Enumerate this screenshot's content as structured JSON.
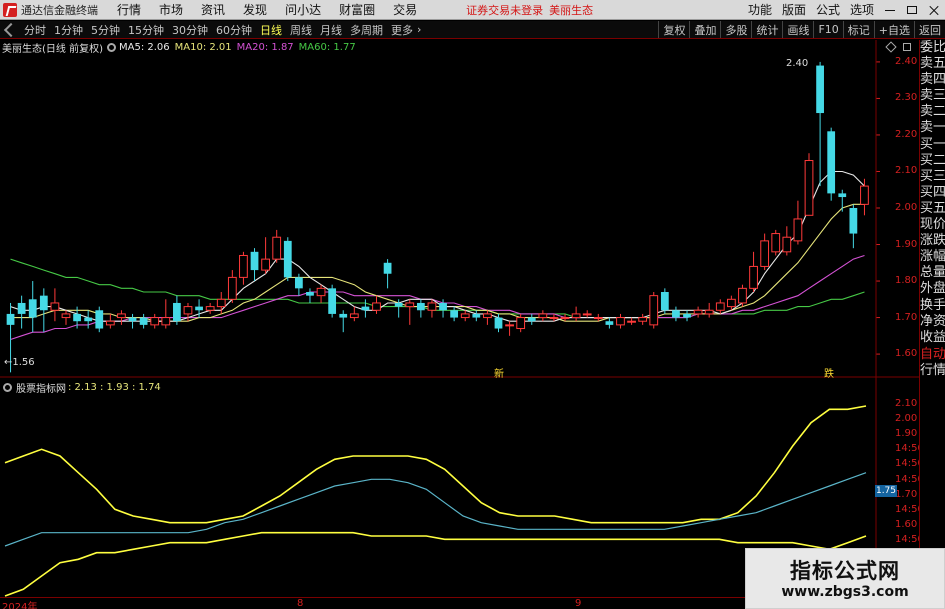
{
  "menubar": {
    "app_title": "通达信金融终端",
    "items": [
      "行情",
      "市场",
      "资讯",
      "发现",
      "问小达",
      "财富圈",
      "交易"
    ],
    "alert": "证券交易未登录",
    "current_stock": "美丽生态",
    "right_items": [
      "功能",
      "版面",
      "公式",
      "选项"
    ]
  },
  "periodbar": {
    "periods": [
      "分时",
      "1分钟",
      "5分钟",
      "15分钟",
      "30分钟",
      "60分钟",
      "日线",
      "周线",
      "月线",
      "多周期",
      "更多"
    ],
    "active_period": "日线",
    "tools": [
      "复权",
      "叠加",
      "多股",
      "统计",
      "画线",
      "F10",
      "标记",
      "+自选",
      "返回"
    ]
  },
  "chart_header": {
    "stock_label": "美丽生态(日线 前复权)",
    "ma5": "MA5: 2.06",
    "ma10": "MA10: 2.01",
    "ma20": "MA20: 1.87",
    "ma60": "MA60: 1.77"
  },
  "indicator_header": {
    "name": "股票指标网",
    "values": ": 2.13 : 1.93 : 1.74"
  },
  "price_axis": [
    "2.40",
    "2.30",
    "2.20",
    "2.10",
    "2.00",
    "1.90",
    "1.80",
    "1.70",
    "1.60"
  ],
  "indicator_axis": [
    "2.10",
    "2.00",
    "1.90",
    "14:50",
    "14:50",
    "14:50",
    "1.70",
    "14:50",
    "1.60",
    "14:50"
  ],
  "indicator_value_box": "1.75",
  "annotations": {
    "high": "2.40",
    "low": "←1.56",
    "low_marker": "新",
    "high_marker": "跌"
  },
  "date_axis": [
    "2024年",
    "8",
    "9"
  ],
  "side_panel": {
    "top": [
      "委比",
      "卖五",
      "卖四",
      "卖三",
      "卖二",
      "卖一",
      "买一",
      "买二",
      "买三",
      "买四",
      "买五",
      "现价",
      "涨跌",
      "涨幅",
      "总量",
      "外盘",
      "换手",
      "净资",
      "收益"
    ],
    "bottom": [
      "自动",
      "行情"
    ]
  },
  "watermark": {
    "title": "指标公式网",
    "url": "www.zbgs3.com"
  },
  "colors": {
    "up": "#ff3a3a",
    "down": "#45d9e6",
    "ma5": "#e8e8e8",
    "ma10": "#e6e47a",
    "ma20": "#d452d4",
    "ma60": "#46c846",
    "band_upper": "#ffff40",
    "band_mid": "#5ab4c8",
    "band_lower": "#ffff40"
  },
  "chart_data": [
    {
      "type": "candlestick",
      "title": "美丽生态(日线 前复权)",
      "ylim": [
        1.54,
        2.46
      ],
      "x_labels": [
        "2024年",
        "8",
        "9"
      ],
      "candles": [
        [
          1.71,
          1.68,
          1.74,
          1.55
        ],
        [
          1.74,
          1.71,
          1.76,
          1.67
        ],
        [
          1.75,
          1.7,
          1.8,
          1.66
        ],
        [
          1.76,
          1.72,
          1.78,
          1.66
        ],
        [
          1.72,
          1.74,
          1.78,
          1.69
        ],
        [
          1.7,
          1.71,
          1.72,
          1.68
        ],
        [
          1.71,
          1.69,
          1.73,
          1.67
        ],
        [
          1.7,
          1.69,
          1.72,
          1.67
        ],
        [
          1.72,
          1.67,
          1.73,
          1.66
        ],
        [
          1.68,
          1.69,
          1.71,
          1.67
        ],
        [
          1.7,
          1.71,
          1.72,
          1.68
        ],
        [
          1.7,
          1.69,
          1.71,
          1.67
        ],
        [
          1.7,
          1.68,
          1.71,
          1.67
        ],
        [
          1.68,
          1.7,
          1.71,
          1.67
        ],
        [
          1.68,
          1.7,
          1.75,
          1.67
        ],
        [
          1.74,
          1.69,
          1.76,
          1.68
        ],
        [
          1.71,
          1.73,
          1.74,
          1.69
        ],
        [
          1.73,
          1.72,
          1.75,
          1.7
        ],
        [
          1.72,
          1.73,
          1.74,
          1.71
        ],
        [
          1.73,
          1.75,
          1.77,
          1.71
        ],
        [
          1.75,
          1.81,
          1.83,
          1.74
        ],
        [
          1.81,
          1.87,
          1.88,
          1.79
        ],
        [
          1.88,
          1.83,
          1.89,
          1.8
        ],
        [
          1.83,
          1.86,
          1.92,
          1.82
        ],
        [
          1.86,
          1.92,
          1.94,
          1.85
        ],
        [
          1.91,
          1.81,
          1.92,
          1.8
        ],
        [
          1.81,
          1.78,
          1.82,
          1.76
        ],
        [
          1.77,
          1.76,
          1.78,
          1.74
        ],
        [
          1.76,
          1.78,
          1.79,
          1.74
        ],
        [
          1.78,
          1.71,
          1.79,
          1.7
        ],
        [
          1.71,
          1.7,
          1.72,
          1.66
        ],
        [
          1.7,
          1.71,
          1.73,
          1.69
        ],
        [
          1.73,
          1.72,
          1.75,
          1.7
        ],
        [
          1.72,
          1.74,
          1.76,
          1.71
        ],
        [
          1.85,
          1.82,
          1.86,
          1.78
        ],
        [
          1.74,
          1.73,
          1.75,
          1.7
        ],
        [
          1.73,
          1.74,
          1.75,
          1.68
        ],
        [
          1.74,
          1.72,
          1.75,
          1.7
        ],
        [
          1.72,
          1.74,
          1.75,
          1.7
        ],
        [
          1.74,
          1.72,
          1.75,
          1.7
        ],
        [
          1.72,
          1.7,
          1.73,
          1.69
        ],
        [
          1.7,
          1.71,
          1.72,
          1.69
        ],
        [
          1.71,
          1.7,
          1.72,
          1.69
        ],
        [
          1.7,
          1.71,
          1.72,
          1.68
        ],
        [
          1.7,
          1.67,
          1.71,
          1.66
        ],
        [
          1.68,
          1.68,
          1.69,
          1.65
        ],
        [
          1.67,
          1.7,
          1.71,
          1.66
        ],
        [
          1.7,
          1.69,
          1.71,
          1.68
        ],
        [
          1.7,
          1.71,
          1.72,
          1.69
        ],
        [
          1.7,
          1.7,
          1.71,
          1.69
        ],
        [
          1.7,
          1.7,
          1.71,
          1.69
        ],
        [
          1.7,
          1.71,
          1.73,
          1.69
        ],
        [
          1.71,
          1.71,
          1.72,
          1.7
        ],
        [
          1.7,
          1.7,
          1.71,
          1.69
        ],
        [
          1.69,
          1.68,
          1.7,
          1.67
        ],
        [
          1.68,
          1.7,
          1.71,
          1.67
        ],
        [
          1.69,
          1.69,
          1.7,
          1.68
        ],
        [
          1.69,
          1.7,
          1.71,
          1.68
        ],
        [
          1.68,
          1.76,
          1.77,
          1.67
        ],
        [
          1.77,
          1.72,
          1.78,
          1.71
        ],
        [
          1.72,
          1.7,
          1.73,
          1.69
        ],
        [
          1.71,
          1.7,
          1.72,
          1.69
        ],
        [
          1.71,
          1.72,
          1.73,
          1.7
        ],
        [
          1.71,
          1.72,
          1.74,
          1.7
        ],
        [
          1.72,
          1.74,
          1.75,
          1.71
        ],
        [
          1.73,
          1.75,
          1.76,
          1.72
        ],
        [
          1.74,
          1.78,
          1.79,
          1.73
        ],
        [
          1.78,
          1.84,
          1.88,
          1.77
        ],
        [
          1.84,
          1.91,
          1.93,
          1.83
        ],
        [
          1.88,
          1.93,
          1.94,
          1.87
        ],
        [
          1.88,
          1.92,
          1.95,
          1.87
        ],
        [
          1.91,
          1.97,
          2.02,
          1.9
        ],
        [
          1.98,
          2.13,
          2.15,
          1.98
        ],
        [
          2.39,
          2.26,
          2.4,
          2.06
        ],
        [
          2.21,
          2.04,
          2.22,
          2.02
        ],
        [
          2.04,
          2.03,
          2.05,
          1.99
        ],
        [
          2.0,
          1.93,
          2.01,
          1.89
        ],
        [
          2.01,
          2.06,
          2.08,
          1.98
        ]
      ],
      "ma5": [
        1.73,
        1.72,
        1.72,
        1.73,
        1.73,
        1.72,
        1.71,
        1.7,
        1.69,
        1.69,
        1.69,
        1.69,
        1.69,
        1.69,
        1.69,
        1.69,
        1.7,
        1.71,
        1.72,
        1.72,
        1.75,
        1.78,
        1.8,
        1.82,
        1.86,
        1.86,
        1.84,
        1.81,
        1.79,
        1.77,
        1.75,
        1.73,
        1.72,
        1.72,
        1.74,
        1.74,
        1.75,
        1.75,
        1.75,
        1.73,
        1.73,
        1.72,
        1.71,
        1.71,
        1.7,
        1.69,
        1.69,
        1.69,
        1.69,
        1.69,
        1.7,
        1.7,
        1.7,
        1.7,
        1.7,
        1.7,
        1.7,
        1.7,
        1.71,
        1.72,
        1.72,
        1.72,
        1.72,
        1.72,
        1.71,
        1.72,
        1.74,
        1.77,
        1.82,
        1.86,
        1.9,
        1.93,
        2.0,
        2.07,
        2.1,
        2.1,
        2.09,
        2.06
      ],
      "ma10": [
        1.7,
        1.7,
        1.7,
        1.71,
        1.72,
        1.72,
        1.72,
        1.72,
        1.71,
        1.71,
        1.7,
        1.7,
        1.7,
        1.69,
        1.69,
        1.69,
        1.69,
        1.7,
        1.7,
        1.71,
        1.72,
        1.74,
        1.75,
        1.77,
        1.79,
        1.81,
        1.81,
        1.81,
        1.81,
        1.81,
        1.8,
        1.79,
        1.77,
        1.76,
        1.75,
        1.74,
        1.73,
        1.73,
        1.73,
        1.73,
        1.73,
        1.73,
        1.72,
        1.72,
        1.71,
        1.71,
        1.7,
        1.7,
        1.7,
        1.7,
        1.69,
        1.69,
        1.69,
        1.69,
        1.7,
        1.7,
        1.7,
        1.7,
        1.7,
        1.71,
        1.71,
        1.71,
        1.71,
        1.71,
        1.71,
        1.72,
        1.73,
        1.74,
        1.76,
        1.79,
        1.82,
        1.85,
        1.89,
        1.93,
        1.97,
        2.0,
        2.01,
        2.01
      ],
      "ma20": [
        1.64,
        1.65,
        1.66,
        1.66,
        1.67,
        1.67,
        1.68,
        1.68,
        1.69,
        1.69,
        1.69,
        1.7,
        1.7,
        1.7,
        1.7,
        1.7,
        1.7,
        1.7,
        1.7,
        1.7,
        1.71,
        1.72,
        1.73,
        1.74,
        1.75,
        1.76,
        1.76,
        1.77,
        1.77,
        1.77,
        1.77,
        1.76,
        1.76,
        1.76,
        1.76,
        1.76,
        1.76,
        1.75,
        1.75,
        1.74,
        1.74,
        1.73,
        1.73,
        1.72,
        1.72,
        1.72,
        1.71,
        1.71,
        1.71,
        1.71,
        1.7,
        1.7,
        1.7,
        1.7,
        1.7,
        1.7,
        1.7,
        1.7,
        1.7,
        1.7,
        1.7,
        1.7,
        1.71,
        1.71,
        1.71,
        1.71,
        1.72,
        1.72,
        1.73,
        1.74,
        1.75,
        1.76,
        1.78,
        1.8,
        1.82,
        1.84,
        1.86,
        1.87
      ],
      "ma60": [
        1.86,
        1.85,
        1.84,
        1.83,
        1.82,
        1.81,
        1.81,
        1.8,
        1.79,
        1.79,
        1.78,
        1.78,
        1.77,
        1.77,
        1.77,
        1.76,
        1.76,
        1.76,
        1.75,
        1.75,
        1.75,
        1.75,
        1.75,
        1.75,
        1.75,
        1.75,
        1.74,
        1.74,
        1.74,
        1.74,
        1.74,
        1.74,
        1.74,
        1.73,
        1.73,
        1.73,
        1.73,
        1.73,
        1.72,
        1.72,
        1.72,
        1.72,
        1.72,
        1.72,
        1.71,
        1.71,
        1.71,
        1.71,
        1.71,
        1.71,
        1.71,
        1.7,
        1.7,
        1.7,
        1.7,
        1.7,
        1.7,
        1.7,
        1.7,
        1.7,
        1.7,
        1.7,
        1.71,
        1.71,
        1.71,
        1.71,
        1.71,
        1.71,
        1.72,
        1.72,
        1.72,
        1.73,
        1.73,
        1.74,
        1.75,
        1.75,
        1.76,
        1.77
      ]
    },
    {
      "type": "line",
      "title": "股票指标网",
      "ylim": [
        1.56,
        2.16
      ],
      "series": [
        {
          "values": [
            1.96,
            1.98,
            2.0,
            1.98,
            1.93,
            1.88,
            1.82,
            1.8,
            1.79,
            1.78,
            1.78,
            1.78,
            1.79,
            1.8,
            1.83,
            1.86,
            1.9,
            1.94,
            1.97,
            1.98,
            1.98,
            1.98,
            1.98,
            1.97,
            1.94,
            1.89,
            1.84,
            1.81,
            1.8,
            1.8,
            1.8,
            1.79,
            1.78,
            1.78,
            1.78,
            1.78,
            1.78,
            1.78,
            1.79,
            1.79,
            1.81,
            1.86,
            1.93,
            2.01,
            2.08,
            2.12,
            2.12,
            2.13
          ]
        },
        {
          "values": [
            1.71,
            1.73,
            1.75,
            1.75,
            1.75,
            1.75,
            1.75,
            1.75,
            1.75,
            1.75,
            1.75,
            1.76,
            1.78,
            1.79,
            1.81,
            1.83,
            1.85,
            1.87,
            1.89,
            1.9,
            1.91,
            1.91,
            1.9,
            1.88,
            1.84,
            1.8,
            1.78,
            1.77,
            1.76,
            1.76,
            1.76,
            1.76,
            1.76,
            1.76,
            1.76,
            1.76,
            1.76,
            1.77,
            1.78,
            1.79,
            1.8,
            1.81,
            1.83,
            1.85,
            1.87,
            1.89,
            1.91,
            1.93
          ]
        },
        {
          "values": [
            1.56,
            1.58,
            1.62,
            1.66,
            1.67,
            1.69,
            1.69,
            1.7,
            1.71,
            1.72,
            1.72,
            1.72,
            1.73,
            1.74,
            1.75,
            1.75,
            1.75,
            1.75,
            1.75,
            1.75,
            1.74,
            1.74,
            1.74,
            1.74,
            1.73,
            1.73,
            1.73,
            1.73,
            1.73,
            1.73,
            1.73,
            1.73,
            1.73,
            1.73,
            1.73,
            1.73,
            1.73,
            1.73,
            1.73,
            1.73,
            1.72,
            1.72,
            1.72,
            1.72,
            1.71,
            1.7,
            1.72,
            1.74
          ]
        }
      ]
    }
  ]
}
